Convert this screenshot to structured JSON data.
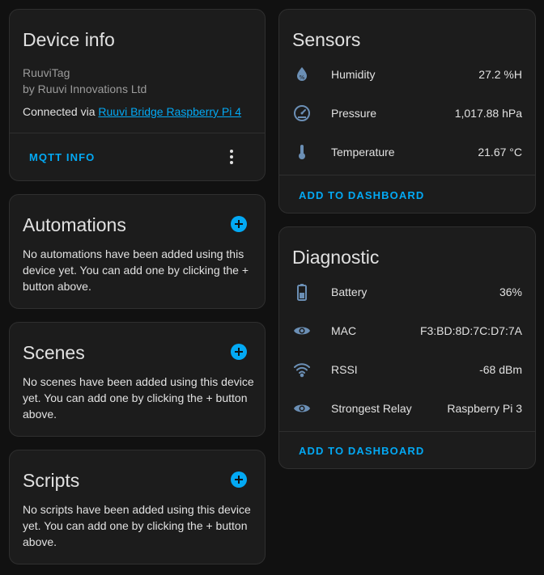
{
  "device_info": {
    "title": "Device info",
    "model": "RuuviTag",
    "manufacturer": "by Ruuvi Innovations Ltd",
    "connected_prefix": "Connected via ",
    "connected_link": "Ruuvi Bridge Raspberry Pi 4",
    "action_label": "MQTT INFO",
    "menu_icon": "dots-vertical-icon"
  },
  "automations": {
    "title": "Automations",
    "text": "No automations have been added using this device yet. You can add one by clicking the + button above."
  },
  "scenes": {
    "title": "Scenes",
    "text": "No scenes have been added using this device yet. You can add one by clicking the + button above."
  },
  "scripts": {
    "title": "Scripts",
    "text": "No scripts have been added using this device yet. You can add one by clicking the + button above."
  },
  "sensors": {
    "title": "Sensors",
    "items": [
      {
        "label": "Humidity",
        "value": "27.2 %H",
        "icon": "water-percent-icon"
      },
      {
        "label": "Pressure",
        "value": "1,017.88 hPa",
        "icon": "gauge-icon"
      },
      {
        "label": "Temperature",
        "value": "21.67 °C",
        "icon": "thermometer-icon"
      }
    ],
    "action_label": "ADD TO DASHBOARD"
  },
  "diagnostic": {
    "title": "Diagnostic",
    "items": [
      {
        "label": "Battery",
        "value": "36%",
        "icon": "battery-icon"
      },
      {
        "label": "MAC",
        "value": "F3:BD:8D:7C:D7:7A",
        "icon": "eye-icon"
      },
      {
        "label": "RSSI",
        "value": "-68 dBm",
        "icon": "wifi-icon"
      },
      {
        "label": "Strongest Relay",
        "value": "Raspberry Pi 3",
        "icon": "eye-icon"
      }
    ],
    "action_label": "ADD TO DASHBOARD"
  },
  "colors": {
    "accent": "#03a9f4",
    "icon": "#6b8fb5",
    "card_bg": "#1c1c1c",
    "page_bg": "#111111"
  }
}
